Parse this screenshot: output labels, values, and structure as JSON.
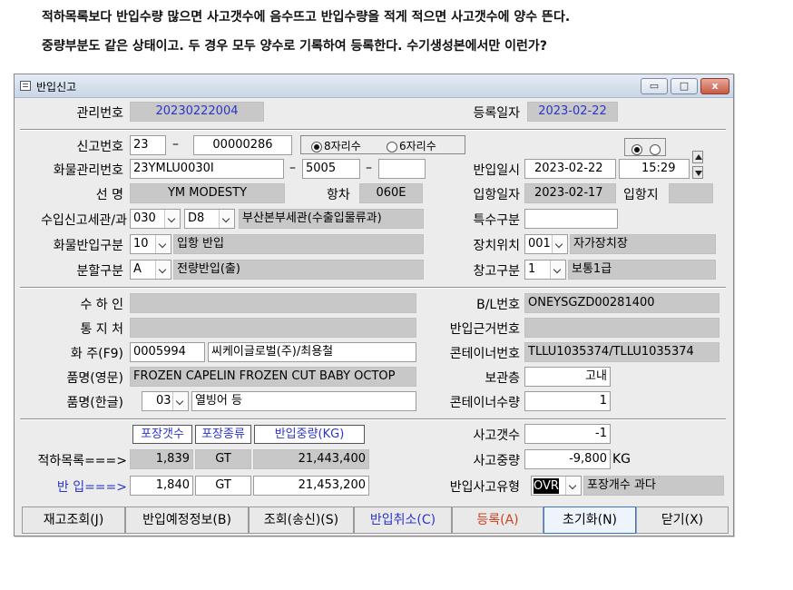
{
  "notes": [
    "적하목록보다 반입수량 많으면 사고갯수에 음수뜨고 반입수량을 적게 적으면 사고갯수에 양수 뜬다.",
    "중량부분도 같은 상태이고. 두 경우 모두 양수로 기록하여 등록한다. 수기생성본에서만 이런가?"
  ],
  "window": {
    "title": "반입신고",
    "min_label": "▭",
    "max_label": "□",
    "close_label": "x"
  },
  "form": {
    "mgmt_no_label": "관리번호",
    "mgmt_no": "20230222004",
    "reg_date_label": "등록일자",
    "reg_date": "2023-02-22",
    "report_no_label": "신고번호",
    "report_no_a": "23",
    "report_no_dash": "–",
    "report_no_b": "00000286",
    "digit8_label": "8자리수",
    "digit6_label": "6자리수",
    "cargo_mgmt_label": "화물관리번호",
    "cargo_mgmt_a": "23YMLU0030I",
    "cargo_mgmt_b": "5005",
    "cargo_mgmt_c": "",
    "dash": "–",
    "arrival_date_label": "반입일시",
    "arrival_date": "2023-02-22",
    "arrival_time": "15:29",
    "ship_label": "선      명",
    "ship": "YM MODESTY",
    "voyage_label": "항차",
    "voyage": "060E",
    "port_date_label": "입항일자",
    "port_date": "2023-02-17",
    "port_label": "입항지",
    "port": "",
    "customs_label": "수입신고세관/과",
    "customs_code": "030",
    "customs_div": "D8",
    "customs_name": "부산본부세관(수출입물류과)",
    "special_label": "특수구분",
    "special": "",
    "cargo_type_label": "화물반입구분",
    "cargo_type_code": "10",
    "cargo_type_name": "입항 반입",
    "location_label": "장치위치",
    "location_code": "001",
    "location_name": "자가장치장",
    "split_label": "분할구분",
    "split_code": "A",
    "split_name": "전량반입(출)",
    "warehouse_label": "창고구분",
    "warehouse_code": "1",
    "warehouse_name": "보통1급",
    "consignee_label": "수 하 인",
    "consignee": "",
    "bl_label": "B/L번호",
    "bl": "ONEYSGZD00281400",
    "notify_label": "통 지 처",
    "notify": "",
    "basis_label": "반입근거번호",
    "basis": "",
    "owner_label": "화  주(F9)",
    "owner_code": "0005994",
    "owner_name": "씨케이글로벌(주)/최용철",
    "container_label": "콘테이너번호",
    "container": "TLLU1035374/TLLU1035374",
    "item_en_label": "품명(영문)",
    "item_en": "FROZEN CAPELIN FROZEN CUT BABY OCTOP",
    "storage_label": "보관층",
    "storage": "고내",
    "item_ko_label": "품명(한글)",
    "item_ko_code": "03",
    "item_ko_name": "열빙어 등",
    "container_qty_label": "콘테이너수량",
    "container_qty": "1"
  },
  "quantities": {
    "hdr_pkg_qty": "포장갯수",
    "hdr_pkg_type": "포장종류",
    "hdr_weight": "반입중량(KG)",
    "manifest_label": "적하목록===>",
    "manifest_qty": "1,839",
    "manifest_type": "GT",
    "manifest_weight": "21,443,400",
    "in_label": "반    입===>",
    "in_qty": "1,840",
    "in_type": "GT",
    "in_weight": "21,453,200",
    "accident_qty_label": "사고갯수",
    "accident_qty": "-1",
    "accident_weight_label": "사고중량",
    "accident_weight": "-9,800",
    "accident_weight_unit": "KG",
    "accident_type_label": "반입사고유형",
    "accident_type_code": "OVR",
    "accident_type_name": "포장개수 과다"
  },
  "buttons": [
    {
      "label": "재고조회(J)"
    },
    {
      "label": "반입예정정보(B)"
    },
    {
      "label": "조회(송신)(S)"
    },
    {
      "label": "반입취소(C)"
    },
    {
      "label": "등록(A)"
    },
    {
      "label": "초기화(N)"
    },
    {
      "label": "닫기(X)"
    }
  ],
  "colors": {
    "accent_blue": "#2b35c8",
    "accent_red": "#c8431e",
    "readonly_gray": "#c8c8c8"
  }
}
